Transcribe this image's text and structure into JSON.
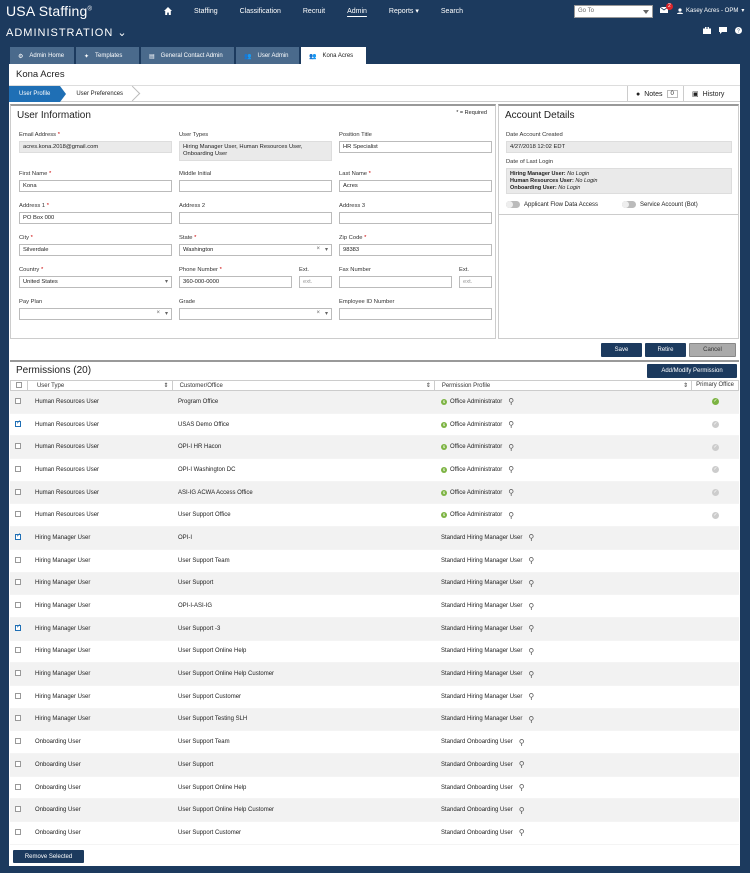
{
  "brand": {
    "name": "USA Staffing",
    "reg": "®"
  },
  "nav": {
    "items": [
      "Staffing",
      "Classification",
      "Recruit",
      "Admin",
      "Reports",
      "Search"
    ],
    "goto_placeholder": "Go To",
    "mail_count": "2",
    "user": "Kasey Acres - OPM"
  },
  "admin": {
    "title": "ADMINISTRATION"
  },
  "tabs": [
    "Admin Home",
    "Templates",
    "General Contact Admin",
    "User Admin",
    "Kona Acres"
  ],
  "page": {
    "title": "Kona Acres",
    "crumb_profile": "User Profile",
    "crumb_prefs": "User Preferences",
    "notes_label": "Notes",
    "notes_count": "0",
    "history_label": "History"
  },
  "userinfo": {
    "title": "User Information",
    "required": "* = Required",
    "email_label": "Email Address",
    "email_value": "acres.kona.2018@gmail.com",
    "usertypes_label": "User Types",
    "usertypes_value": "Hiring Manager User, Human Resources User, Onboarding User",
    "position_label": "Position Title",
    "position_value": "HR Specialist",
    "first_label": "First Name",
    "first_value": "Kona",
    "middle_label": "Middle Initial",
    "middle_value": "",
    "last_label": "Last Name",
    "last_value": "Acres",
    "addr1_label": "Address 1",
    "addr1_value": "PO Box 000",
    "addr2_label": "Address 2",
    "addr2_value": "",
    "addr3_label": "Address 3",
    "addr3_value": "",
    "city_label": "City",
    "city_value": "Silverdale",
    "state_label": "State",
    "state_value": "Washington",
    "zip_label": "Zip Code",
    "zip_value": "98383",
    "country_label": "Country",
    "country_value": "United States",
    "phone_label": "Phone Number",
    "phone_value": "360-000-0000",
    "ext_label": "Ext.",
    "ext_placeholder": "ext.",
    "fax_label": "Fax Number",
    "fax_value": "",
    "ext2_label": "Ext.",
    "ext2_placeholder": "ext.",
    "payplan_label": "Pay Plan",
    "payplan_value": "",
    "grade_label": "Grade",
    "grade_value": "",
    "empid_label": "Employee ID Number",
    "empid_value": ""
  },
  "account": {
    "title": "Account Details",
    "created_label": "Date Account Created",
    "created_value": "4/27/2018 12:02 EDT",
    "lastlogin_label": "Date of Last Login",
    "logins": [
      {
        "type": "Hiring Manager User:",
        "val": "No Login"
      },
      {
        "type": "Human Resources User:",
        "val": "No Login"
      },
      {
        "type": "Onboarding User:",
        "val": "No Login"
      }
    ],
    "flow_label": "Applicant Flow Data Access",
    "service_label": "Service Account (Bot)"
  },
  "buttons": {
    "save": "Save",
    "retire": "Retire",
    "cancel": "Cancel",
    "add_modify": "Add/Modify Permission",
    "remove_selected": "Remove Selected"
  },
  "permissions": {
    "title": "Permissions (20)",
    "headers": [
      "User Type",
      "Customer/Office",
      "Permission Profile",
      "Primary Office"
    ],
    "rows": [
      {
        "checked": false,
        "type": "Human Resources User",
        "office": "Program Office",
        "profile": "Office Administrator",
        "admin": true,
        "primary": "on"
      },
      {
        "checked": true,
        "type": "Human Resources User",
        "office": "USAS Demo Office",
        "profile": "Office Administrator",
        "admin": true,
        "primary": "off"
      },
      {
        "checked": false,
        "type": "Human Resources User",
        "office": "OPI-I HR Hacon",
        "profile": "Office Administrator",
        "admin": true,
        "primary": "off"
      },
      {
        "checked": false,
        "type": "Human Resources User",
        "office": "OPI-I Washington DC",
        "profile": "Office Administrator",
        "admin": true,
        "primary": "off"
      },
      {
        "checked": false,
        "type": "Human Resources User",
        "office": "ASI-IG ACWA Access Office",
        "profile": "Office Administrator",
        "admin": true,
        "primary": "off"
      },
      {
        "checked": false,
        "type": "Human Resources User",
        "office": "User Support Office",
        "profile": "Office Administrator",
        "admin": true,
        "primary": "off"
      },
      {
        "checked": true,
        "type": "Hiring Manager User",
        "office": "OPI-I",
        "profile": "Standard Hiring Manager User",
        "admin": false,
        "primary": ""
      },
      {
        "checked": false,
        "type": "Hiring Manager User",
        "office": "User Support Team",
        "profile": "Standard Hiring Manager User",
        "admin": false,
        "primary": ""
      },
      {
        "checked": false,
        "type": "Hiring Manager User",
        "office": "User Support",
        "profile": "Standard Hiring Manager User",
        "admin": false,
        "primary": ""
      },
      {
        "checked": false,
        "type": "Hiring Manager User",
        "office": "OPI-I-ASI-IG",
        "profile": "Standard Hiring Manager User",
        "admin": false,
        "primary": ""
      },
      {
        "checked": true,
        "type": "Hiring Manager User",
        "office": "User Support -3",
        "profile": "Standard Hiring Manager User",
        "admin": false,
        "primary": ""
      },
      {
        "checked": false,
        "type": "Hiring Manager User",
        "office": "User Support Online Help",
        "profile": "Standard Hiring Manager User",
        "admin": false,
        "primary": ""
      },
      {
        "checked": false,
        "type": "Hiring Manager User",
        "office": "User Support Online Help Customer",
        "profile": "Standard Hiring Manager User",
        "admin": false,
        "primary": ""
      },
      {
        "checked": false,
        "type": "Hiring Manager User",
        "office": "User Support Customer",
        "profile": "Standard Hiring Manager User",
        "admin": false,
        "primary": ""
      },
      {
        "checked": false,
        "type": "Hiring Manager User",
        "office": "User Support Testing SLH",
        "profile": "Standard Hiring Manager User",
        "admin": false,
        "primary": ""
      },
      {
        "checked": false,
        "type": "Onboarding User",
        "office": "User Support Team",
        "profile": "Standard Onboarding User",
        "admin": false,
        "primary": ""
      },
      {
        "checked": false,
        "type": "Onboarding User",
        "office": "User Support",
        "profile": "Standard Onboarding User",
        "admin": false,
        "primary": ""
      },
      {
        "checked": false,
        "type": "Onboarding User",
        "office": "User Support Online Help",
        "profile": "Standard Onboarding User",
        "admin": false,
        "primary": ""
      },
      {
        "checked": false,
        "type": "Onboarding User",
        "office": "User Support Online Help Customer",
        "profile": "Standard Onboarding User",
        "admin": false,
        "primary": ""
      },
      {
        "checked": false,
        "type": "Onboarding User",
        "office": "User Support Customer",
        "profile": "Standard Onboarding User",
        "admin": false,
        "primary": ""
      }
    ]
  },
  "colors": {
    "navy": "#1c3a5e",
    "blue": "#1f6fb5",
    "green": "#7cb342",
    "red": "#d9252b"
  }
}
